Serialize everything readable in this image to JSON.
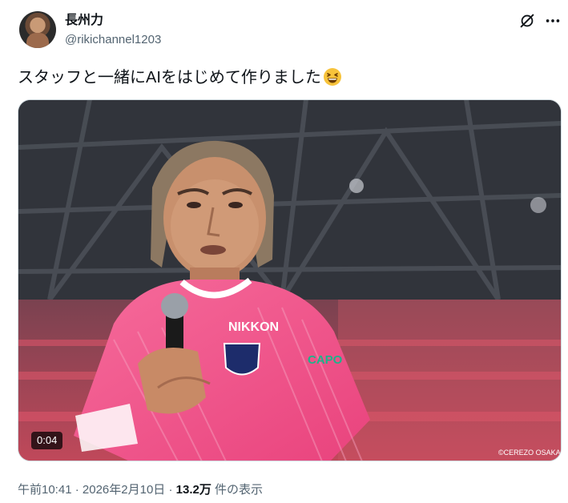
{
  "author": {
    "display_name": "長州力",
    "handle": "@rikichannel1203"
  },
  "header": {
    "grok_icon": "grok-icon",
    "more_icon": "more-dots-icon"
  },
  "tweet": {
    "text": "スタッフと一緒にAIをはじめて作りました",
    "emoji": "grinning-squinting-face-emoji"
  },
  "media": {
    "type": "video",
    "duration": "0:04",
    "watermark": "©CEREZO OSAKA",
    "jersey_sponsor": "NIKKON",
    "sleeve_text": "CAPO"
  },
  "meta": {
    "time": "午前10:41",
    "sep1": " · ",
    "date": "2026年2月10日",
    "sep2": " · ",
    "views_count": "13.2万",
    "views_label": " 件の表示"
  },
  "colors": {
    "text": "#0f1419",
    "secondary": "#536471",
    "jersey_pink": "#f2548a"
  }
}
